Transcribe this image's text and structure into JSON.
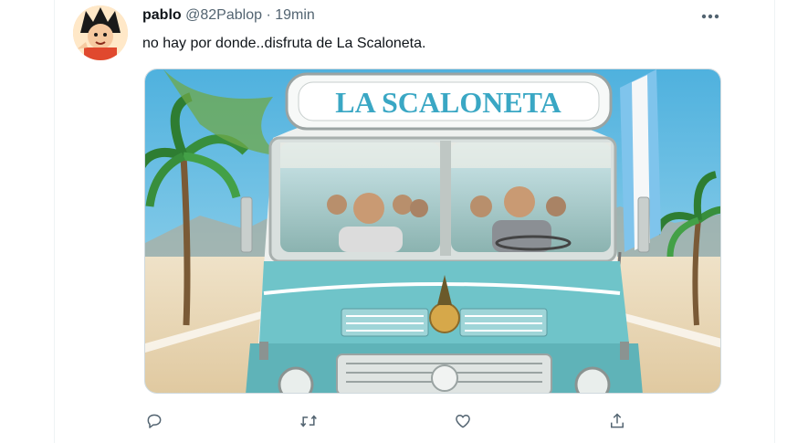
{
  "tweet": {
    "display_name": "pablo",
    "handle": "@82Pablop",
    "separator": "·",
    "time": "19min",
    "text": "no hay por donde..disfruta de La Scaloneta.",
    "media": {
      "bus_sign": "LA SCALONETA"
    }
  },
  "icons": {
    "more": "more-horizontal-icon",
    "reply": "reply-icon",
    "retweet": "retweet-icon",
    "like": "heart-icon",
    "share": "share-icon"
  },
  "colors": {
    "text": "#0f1419",
    "secondary": "#536471",
    "bus_turquoise": "#6fc4c9",
    "sky": "#5fb9e0"
  }
}
